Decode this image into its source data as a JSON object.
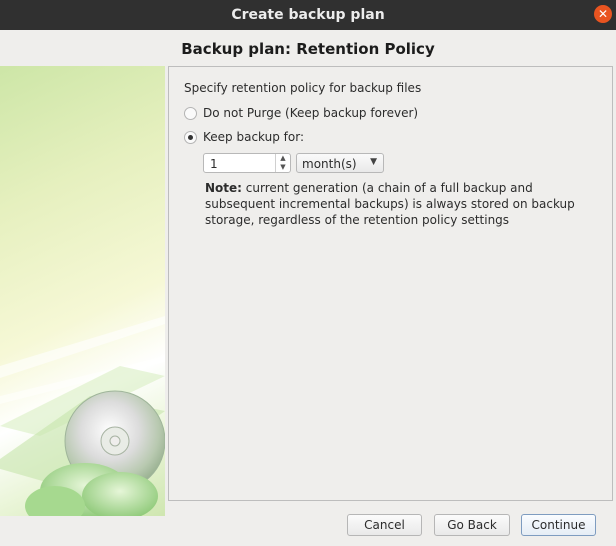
{
  "window": {
    "title": "Create backup plan",
    "close_icon": "close-icon"
  },
  "page": {
    "title": "Backup plan: Retention Policy"
  },
  "retention": {
    "intro": "Specify retention policy for backup files",
    "option_no_purge": "Do not Purge (Keep backup forever)",
    "option_keep": "Keep backup for:",
    "selected_option": "keep",
    "keep_value": "1",
    "keep_unit": "month(s)",
    "note_label": "Note:",
    "note_text": " current generation (a chain of a full backup and subsequent incremental backups) is always stored on backup storage, regardless of the retention policy settings"
  },
  "buttons": {
    "cancel": "Cancel",
    "back": "Go Back",
    "continue": "Continue"
  },
  "colors": {
    "titlebar": "#303030",
    "close": "#e95420",
    "accent": "#7e9cc0"
  }
}
